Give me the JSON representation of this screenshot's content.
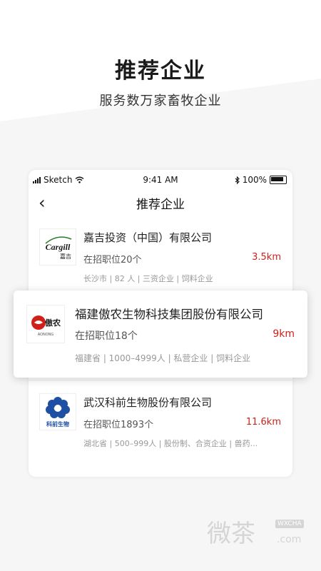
{
  "hero": {
    "title": "推荐企业",
    "subtitle": "服务数万家畜牧企业"
  },
  "status_bar": {
    "carrier": "Sketch",
    "time": "9:41 AM",
    "battery": "100%"
  },
  "nav": {
    "title": "推荐企业"
  },
  "companies": [
    {
      "logo_text": "Cargill",
      "logo_sub": "嘉吉",
      "name": "嘉吉投资（中国）有限公司",
      "jobs": "在招职位20个",
      "distance": "3.5km",
      "tags": "长沙市  |  82 人  |  三资企业  |  饲料企业"
    },
    {
      "logo_text": "傲农",
      "logo_sub": "AONONG",
      "name": "福建傲农生物科技集团股份有限公司",
      "jobs": "在招职位18个",
      "distance": "9km",
      "tags": "福建省  |  1000–4999人  |  私营企业  |  饲料企业"
    },
    {
      "logo_text": "KQ",
      "logo_sub": "科前生物",
      "name": "武汉科前生物股份有限公司",
      "jobs": "在招职位1893个",
      "distance": "11.6km",
      "tags": "湖北省  |  500–999人  |  股份制、合资企业  |  兽药..."
    }
  ],
  "watermark": {
    "main": "微茶",
    "badge": "WXCHA",
    "domain": ".com"
  },
  "colors": {
    "accent": "#d0201a",
    "card_shadow": "#00000030"
  },
  "icons": {
    "back": "chevron-left-icon",
    "wifi": "wifi-icon",
    "bluetooth": "bluetooth-icon",
    "battery": "battery-icon",
    "signal": "signal-icon"
  }
}
